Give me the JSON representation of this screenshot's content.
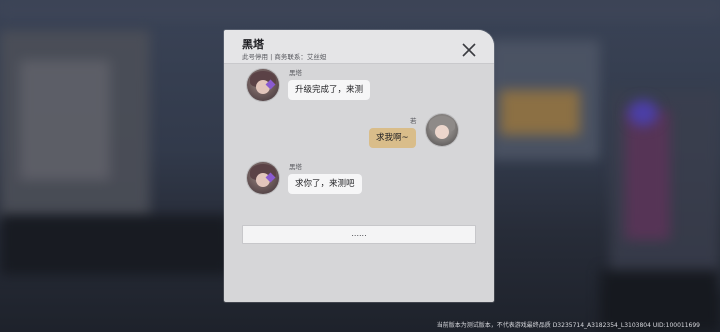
{
  "contact": {
    "name": "黑塔",
    "subtitle": "此号停用 | 商务联系：艾丝妲"
  },
  "messages": [
    {
      "sender": "黑塔",
      "text": "升级完成了，来测",
      "side": "left"
    },
    {
      "sender": "若",
      "text": "求我啊~",
      "side": "right"
    },
    {
      "sender": "黑塔",
      "text": "求你了，来测吧",
      "side": "left"
    }
  ],
  "reply": {
    "label": "......"
  },
  "footer": {
    "text": "当前版本为测试版本，不代表游戏最终品质  D3235714_A3182354_L3103804  UID:100011699"
  },
  "icons": {
    "close": "close-icon"
  },
  "colors": {
    "panel": "#d6d6d8",
    "bubble_self": "#d9bd8a",
    "bubble_other": "#f6f6f7"
  }
}
